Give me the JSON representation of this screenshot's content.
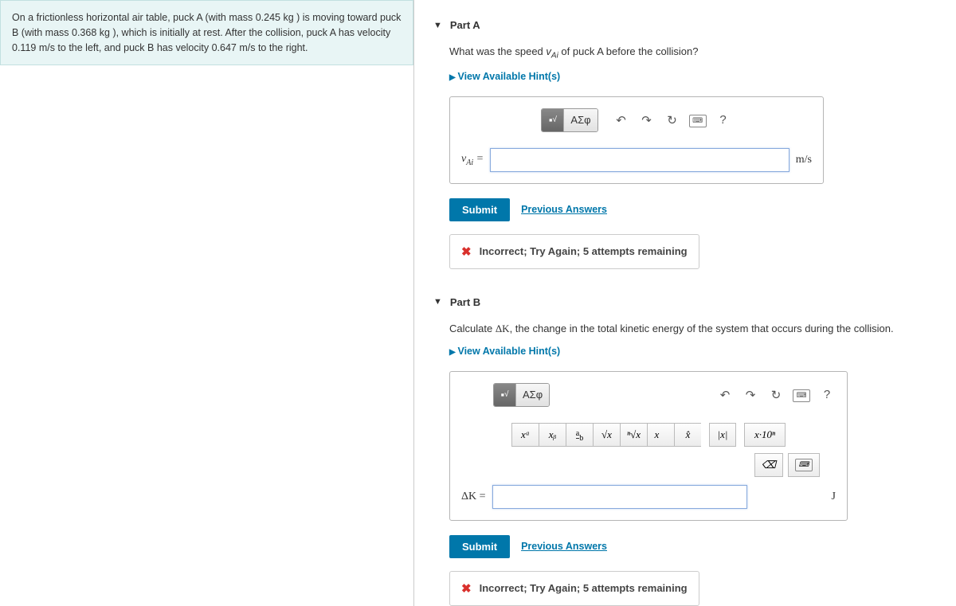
{
  "problem": {
    "text": "On a frictionless horizontal air table, puck A (with mass 0.245 kg ) is moving toward puck B (with mass 0.368 kg ), which is initially at rest. After the collision, puck A has velocity 0.119 m/s to the left, and puck B has velocity 0.647 m/s to the right."
  },
  "partA": {
    "title": "Part A",
    "question_prefix": "What was the speed ",
    "question_var": "v",
    "question_sub": "Ai",
    "question_suffix": " of puck A before the collision?",
    "hints": "View Available Hint(s)",
    "toolbar": {
      "templates": "⎷",
      "greek": "ΑΣφ"
    },
    "var_label": "v",
    "var_sub": "Ai",
    "equals": " = ",
    "unit": "m/s",
    "submit": "Submit",
    "prev": "Previous Answers",
    "feedback": "Incorrect; Try Again; 5 attempts remaining"
  },
  "partB": {
    "title": "Part B",
    "question_prefix": "Calculate ",
    "question_var": "ΔK",
    "question_suffix": ", the change in the total kinetic energy of the system that occurs during the collision.",
    "hints": "View Available Hint(s)",
    "toolbar": {
      "templates": "⎷",
      "greek": "ΑΣφ"
    },
    "sub_btns": {
      "xa": "xᵃ",
      "xb": "xᵦ",
      "frac": "a/b",
      "sqrt": "√x",
      "nroot": "ⁿ√x",
      "vec": "x⃗",
      "hat": "x̂",
      "abs": "|x|",
      "sci": "x·10ⁿ"
    },
    "var_label": "ΔK = ",
    "unit": "J",
    "submit": "Submit",
    "prev": "Previous Answers",
    "feedback": "Incorrect; Try Again; 5 attempts remaining"
  },
  "icons": {
    "undo": "↶",
    "redo": "↷",
    "reset": "↻",
    "keyboard": "⌨",
    "help": "?",
    "backspace": "⌫"
  }
}
